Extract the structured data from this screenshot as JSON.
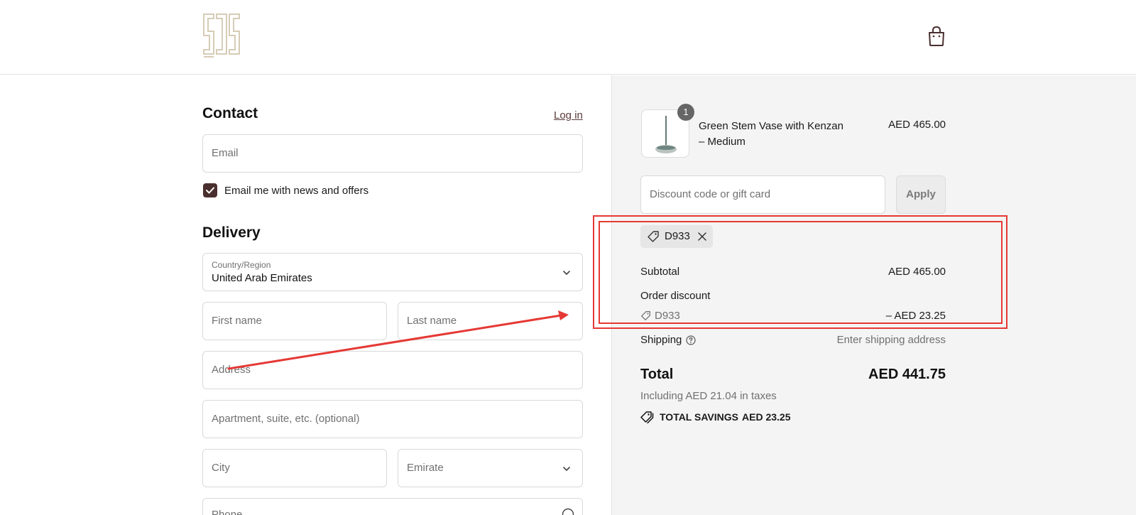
{
  "header": {
    "logo_icon": "store-logo-mark",
    "cart_icon": "shopping-bag-icon"
  },
  "contact": {
    "title": "Contact",
    "login_link": "Log in",
    "email_placeholder": "Email",
    "newsletter_label": "Email me with news and offers",
    "newsletter_checked": true
  },
  "delivery": {
    "title": "Delivery",
    "country_label": "Country/Region",
    "country_value": "United Arab Emirates",
    "first_name_placeholder": "First name",
    "last_name_placeholder": "Last name",
    "address_placeholder": "Address",
    "apartment_placeholder": "Apartment, suite, etc. (optional)",
    "city_placeholder": "City",
    "emirate_placeholder": "Emirate",
    "phone_placeholder": "Phone"
  },
  "summary": {
    "product": {
      "name": "Green Stem Vase with Kenzan – Medium",
      "price": "AED 465.00",
      "quantity": "1"
    },
    "discount_placeholder": "Discount code or gift card",
    "apply_label": "Apply",
    "applied_code": "D933",
    "subtotal_label": "Subtotal",
    "subtotal_value": "AED 465.00",
    "order_discount_label": "Order discount",
    "order_discount_code": "D933",
    "order_discount_value": "– AED 23.25",
    "shipping_label": "Shipping",
    "shipping_value": "Enter shipping address",
    "total_label": "Total",
    "total_value": "AED 441.75",
    "taxes_note": "Including AED 21.04 in taxes",
    "savings_label": "TOTAL SAVINGS",
    "savings_value": "AED 23.25"
  },
  "colors": {
    "brand": "#4a2f2f",
    "annotation": "#e53935"
  }
}
